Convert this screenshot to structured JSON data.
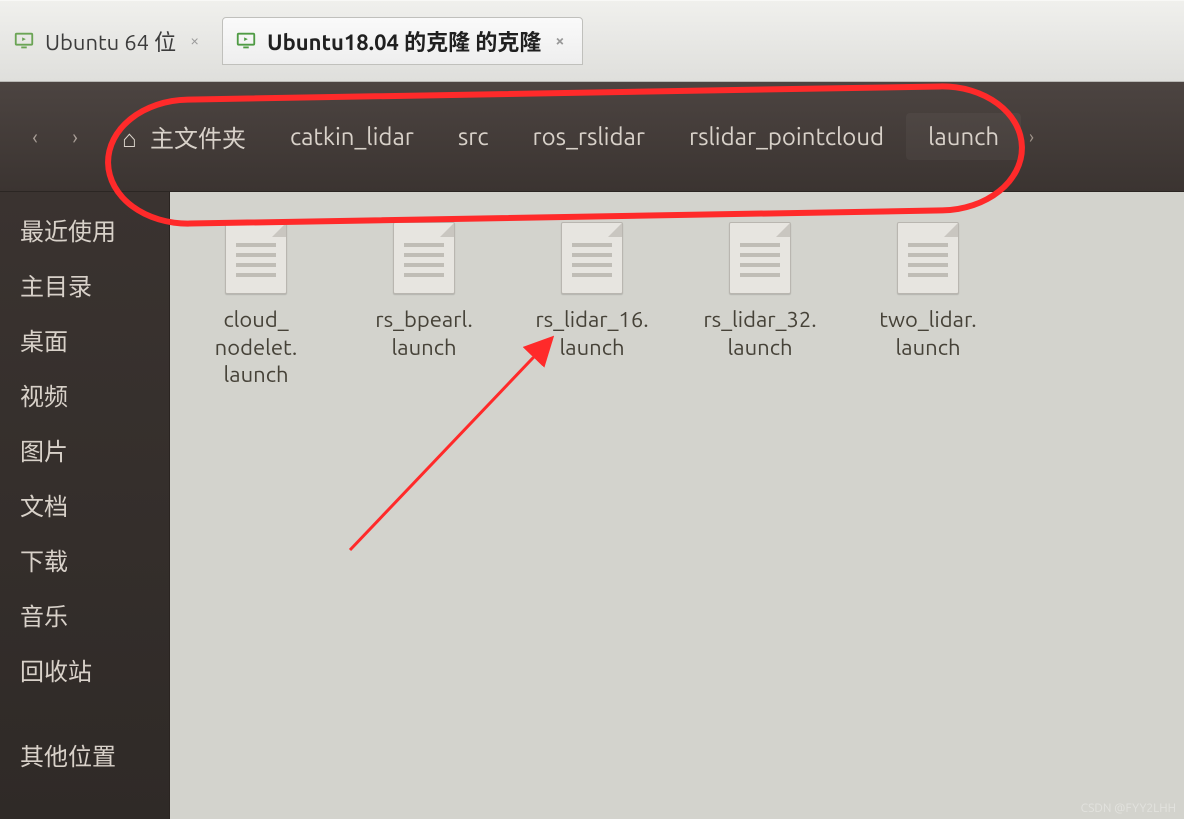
{
  "vm_tabs": [
    {
      "label": "Ubuntu 64 位",
      "active": false
    },
    {
      "label": "Ubuntu18.04 的克隆 的克隆",
      "active": true
    }
  ],
  "nav": {
    "back_glyph": "‹",
    "forward_glyph": "›"
  },
  "breadcrumb": {
    "home_glyph": "⌂",
    "items": [
      "主文件夹",
      "catkin_lidar",
      "src",
      "ros_rslidar",
      "rslidar_pointcloud",
      "launch"
    ],
    "overflow_glyph": "›"
  },
  "sidebar": {
    "items": [
      "最近使用",
      "主目录",
      "桌面",
      "视频",
      "图片",
      "文档",
      "下载",
      "音乐",
      "回收站"
    ],
    "other": "其他位置"
  },
  "files": [
    {
      "name": "cloud_\nnodelet.\nlaunch"
    },
    {
      "name": "rs_bpearl.\nlaunch"
    },
    {
      "name": "rs_lidar_16.\nlaunch"
    },
    {
      "name": "rs_lidar_32.\nlaunch"
    },
    {
      "name": "two_lidar.\nlaunch"
    }
  ],
  "watermark": "CSDN @FYY2LHH"
}
